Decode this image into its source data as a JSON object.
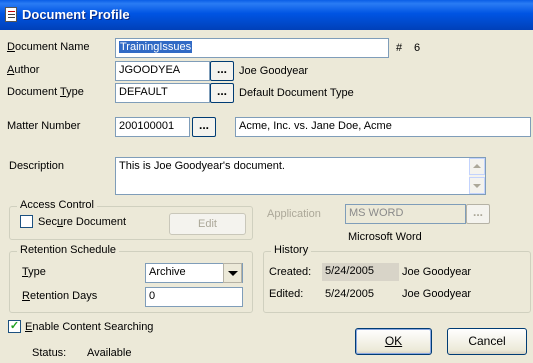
{
  "window": {
    "title": "Document Profile"
  },
  "document_name": {
    "label": "Document Name",
    "value": "TrainingIssues",
    "number_prefix": "#",
    "number": "6"
  },
  "author": {
    "label": "Author",
    "value": "JGOODYEA",
    "button": "...",
    "full_name": "Joe Goodyear"
  },
  "document_type": {
    "label": "Document Type",
    "value": "DEFAULT",
    "button": "...",
    "description": "Default Document Type"
  },
  "matter": {
    "label": "Matter Number",
    "value": "200100001",
    "button": "...",
    "description": "Acme, Inc. vs. Jane Doe, Acme"
  },
  "description": {
    "label": "Description",
    "value": "This is Joe Goodyear's document."
  },
  "access_control": {
    "title": "Access Control",
    "secure_label": "Secure Document",
    "secure_checked": false,
    "edit_button": "Edit"
  },
  "application": {
    "label": "Application",
    "value": "MS WORD",
    "button": "...",
    "description": "Microsoft Word"
  },
  "retention": {
    "title": "Retention Schedule",
    "type_label": "Type",
    "type_value": "Archive",
    "days_label": "Retention Days",
    "days_value": "0"
  },
  "history": {
    "title": "History",
    "created_label": "Created:",
    "created_date": "5/24/2005",
    "created_by": "Joe Goodyear",
    "edited_label": "Edited:",
    "edited_date": "5/24/2005",
    "edited_by": "Joe Goodyear"
  },
  "content_search": {
    "label": "Enable Content Searching",
    "checked": true
  },
  "status": {
    "label": "Status:",
    "value": "Available"
  },
  "buttons": {
    "ok": "OK",
    "cancel": "Cancel"
  },
  "colors": {
    "titlebar": "#0054e3",
    "dialog_bg": "#ece9d8",
    "selection": "#316ac5",
    "field_border": "#7f9db9"
  }
}
